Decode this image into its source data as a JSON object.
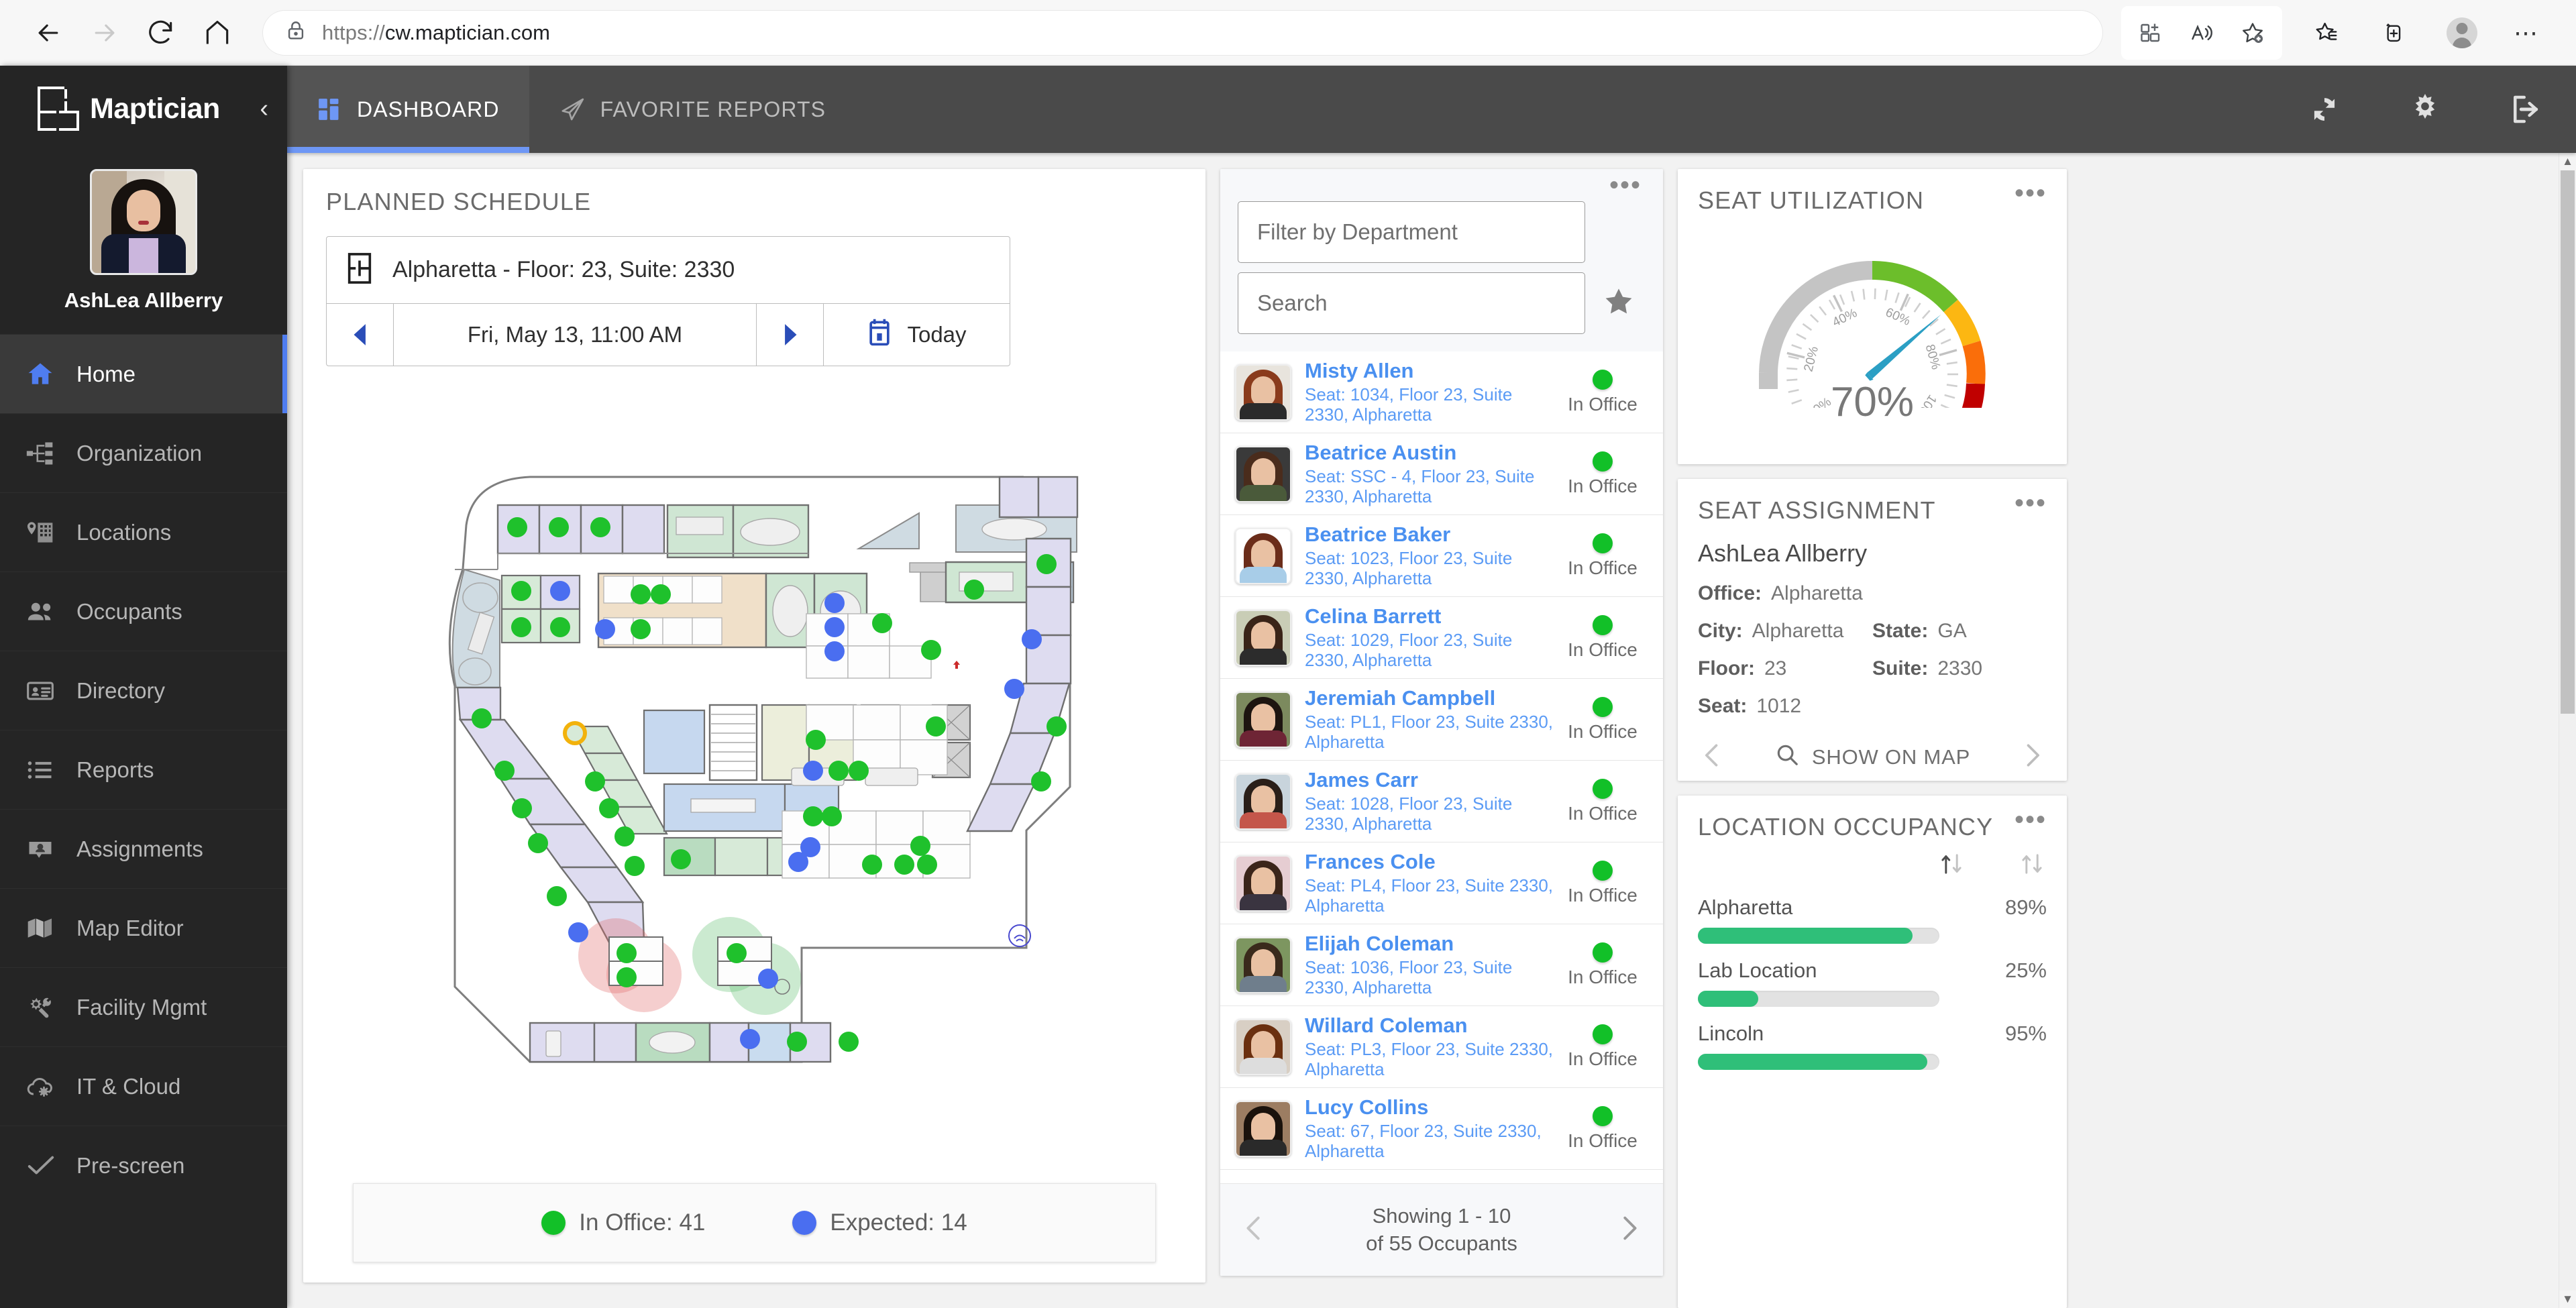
{
  "browser": {
    "url_scheme": "https://",
    "url_host": "cw.maptician.com",
    "back_icon": "back-arrow-icon",
    "forward_icon": "forward-arrow-icon",
    "reload_icon": "reload-icon",
    "home_icon": "home-icon",
    "lock_icon": "lock-icon",
    "split_screen_icon": "split-screen-icon",
    "read_aloud_icon": "read-aloud-icon",
    "add_favorite_icon": "add-favorite-icon",
    "favorites_icon": "favorites-icon",
    "collections_icon": "collections-icon",
    "profile_icon": "profile-avatar-icon",
    "settings_more_icon": "more-options-icon"
  },
  "sidebar": {
    "brand": "Maptician",
    "collapse_label": "‹",
    "user_name": "AshLea Allberry",
    "items": [
      {
        "label": "Home",
        "icon": "home-icon",
        "active": true
      },
      {
        "label": "Organization",
        "icon": "org-chart-icon",
        "active": false
      },
      {
        "label": "Locations",
        "icon": "map-pin-building-icon",
        "active": false
      },
      {
        "label": "Occupants",
        "icon": "people-icon",
        "active": false
      },
      {
        "label": "Directory",
        "icon": "id-card-icon",
        "active": false
      },
      {
        "label": "Reports",
        "icon": "list-icon",
        "active": false
      },
      {
        "label": "Assignments",
        "icon": "person-badge-icon",
        "active": false
      },
      {
        "label": "Map Editor",
        "icon": "folded-map-icon",
        "active": false
      },
      {
        "label": "Facility Mgmt",
        "icon": "gear-wrench-icon",
        "active": false
      },
      {
        "label": "IT & Cloud",
        "icon": "cloud-gear-icon",
        "active": false
      },
      {
        "label": "Pre-screen",
        "icon": "checkmark-icon",
        "active": false
      }
    ]
  },
  "topbar": {
    "tabs": [
      {
        "label": "DASHBOARD",
        "icon": "dashboard-grid-icon",
        "active": true
      },
      {
        "label": "FAVORITE REPORTS",
        "icon": "paper-plane-icon",
        "active": false
      }
    ],
    "actions": [
      {
        "name": "refresh-icon"
      },
      {
        "name": "gear-icon"
      },
      {
        "name": "logout-icon"
      }
    ]
  },
  "schedule": {
    "title": "PLANNED SCHEDULE",
    "location": "Alpharetta - Floor: 23, Suite: 2330",
    "location_icon": "floorplan-icon",
    "prev_icon": "prev-triangle-icon",
    "next_icon": "next-triangle-icon",
    "date": "Fri, May 13, 11:00 AM",
    "today_label": "Today",
    "today_icon": "calendar-icon",
    "legend": [
      {
        "label": "In Office: 41",
        "color": "#12c028"
      },
      {
        "label": "Expected: 14",
        "color": "#4a6ef0"
      }
    ]
  },
  "occupants": {
    "kebab": "•••",
    "filter_placeholder": "Filter by Department",
    "search_placeholder": "Search",
    "star_icon": "favorite-star-icon",
    "rows": [
      {
        "name": "Misty Allen",
        "seat": "Seat: 1034, Floor 23, Suite 2330, Alpharetta",
        "status": "In Office",
        "hair": "#8a3b1c",
        "shirt": "#2b2b2b",
        "bg": "#e8e4dd"
      },
      {
        "name": "Beatrice Austin",
        "seat": "Seat: SSC - 4, Floor 23, Suite 2330, Alpharetta",
        "status": "In Office",
        "hair": "#4a2c1c",
        "shirt": "#4a5a3a",
        "bg": "#3a3a3a"
      },
      {
        "name": "Beatrice Baker",
        "seat": "Seat: 1023, Floor 23, Suite 2330, Alpharetta",
        "status": "In Office",
        "hair": "#6b2d1a",
        "shirt": "#a8cde8",
        "bg": "#ffffff"
      },
      {
        "name": "Celina Barrett",
        "seat": "Seat: 1029, Floor 23, Suite 2330, Alpharetta",
        "status": "In Office",
        "hair": "#3a2418",
        "shirt": "#2c2c2c",
        "bg": "#c9cdb6"
      },
      {
        "name": "Jeremiah Campbell",
        "seat": "Seat: PL1, Floor 23, Suite 2330, Alpharetta",
        "status": "In Office",
        "hair": "#1d1510",
        "shirt": "#6e2535",
        "bg": "#7c8a5e"
      },
      {
        "name": "James Carr",
        "seat": "Seat: 1028, Floor 23, Suite 2330, Alpharetta",
        "status": "In Office",
        "hair": "#2a1f19",
        "shirt": "#c4564a",
        "bg": "#c8d4dc"
      },
      {
        "name": "Frances Cole",
        "seat": "Seat: PL4, Floor 23, Suite 2330, Alpharetta",
        "status": "In Office",
        "hair": "#3b251a",
        "shirt": "#3a3440",
        "bg": "#e6cdd2"
      },
      {
        "name": "Elijah Coleman",
        "seat": "Seat: 1036, Floor 23, Suite 2330, Alpharetta",
        "status": "In Office",
        "hair": "#3a2a1c",
        "shirt": "#6f7e8c",
        "bg": "#7d9660"
      },
      {
        "name": "Willard Coleman",
        "seat": "Seat: PL3, Floor 23, Suite 2330, Alpharetta",
        "status": "In Office",
        "hair": "#6b3010",
        "shirt": "#dddddd",
        "bg": "#d8cfc4"
      },
      {
        "name": "Lucy Collins",
        "seat": "Seat: 67, Floor 23, Suite 2330, Alpharetta",
        "status": "In Office",
        "hair": "#1a120c",
        "shirt": "#2a2a2a",
        "bg": "#9c7d62"
      }
    ],
    "pager_line1": "Showing 1 - 10",
    "pager_line2": "of 55 Occupants",
    "pager_prev_icon": "chevron-left-icon",
    "pager_next_icon": "chevron-right-icon"
  },
  "seat_utilization": {
    "title": "SEAT UTILIZATION",
    "kebab": "•••",
    "value_label": "70%"
  },
  "seat_assignment": {
    "title": "SEAT ASSIGNMENT",
    "kebab": "•••",
    "person": "AshLea Allberry",
    "office_label": "Office:",
    "office_value": "Alpharetta",
    "city_label": "City:",
    "city_value": "Alpharetta",
    "state_label": "State:",
    "state_value": "GA",
    "floor_label": "Floor:",
    "floor_value": "23",
    "suite_label": "Suite:",
    "suite_value": "2330",
    "seat_label": "Seat:",
    "seat_value": "1012",
    "show_on_map": "SHOW ON MAP",
    "show_on_map_icon": "magnifier-icon",
    "prev_icon": "chevron-left-icon",
    "next_icon": "chevron-right-icon"
  },
  "location_occupancy": {
    "title": "LOCATION OCCUPANCY",
    "kebab": "•••",
    "sort_name_icon": "sort-updown-icon",
    "sort_pct_icon": "sort-updown-icon"
  },
  "colors": {
    "accent_blue": "#4f7df0",
    "link_blue": "#4a90f0",
    "in_office_green": "#12c028",
    "expected_blue": "#4a6ef0",
    "bar_green": "#2fbf79",
    "sidebar_bg": "#252525",
    "topbar_bg": "#4a4a4a"
  },
  "chart_data": [
    {
      "type": "gauge",
      "title": "SEAT UTILIZATION",
      "value": 70,
      "unit": "%",
      "min": 0,
      "max": 110,
      "tick_labels": [
        "0%",
        "20%",
        "40%",
        "60%",
        "80%",
        "100%"
      ],
      "bands": [
        {
          "from": 0,
          "to": 50,
          "color": "#c4c4c4"
        },
        {
          "from": 50,
          "to": 75,
          "color": "#6cbe2b"
        },
        {
          "from": 75,
          "to": 85,
          "color": "#fcb712"
        },
        {
          "from": 85,
          "to": 97,
          "color": "#fa6e0a"
        },
        {
          "from": 97,
          "to": 110,
          "color": "#c00000"
        }
      ],
      "needle_color": "#2b9fc4",
      "value_label": "70%"
    },
    {
      "type": "bar",
      "title": "LOCATION OCCUPANCY",
      "orientation": "horizontal",
      "categories": [
        "Alpharetta",
        "Lab Location",
        "Lincoln"
      ],
      "values": [
        89,
        25,
        95
      ],
      "value_labels": [
        "89%",
        "25%",
        "95%"
      ],
      "ylim": [
        0,
        100
      ],
      "bar_color": "#2fbf79",
      "track_color": "#e2e2e2"
    },
    {
      "type": "floorplan",
      "title": "PLANNED SCHEDULE",
      "location": "Alpharetta - Floor: 23, Suite: 2330",
      "legend": [
        {
          "label": "In Office",
          "count": 41,
          "color": "#12c028"
        },
        {
          "label": "Expected",
          "count": 14,
          "color": "#4a6ef0"
        }
      ]
    }
  ]
}
